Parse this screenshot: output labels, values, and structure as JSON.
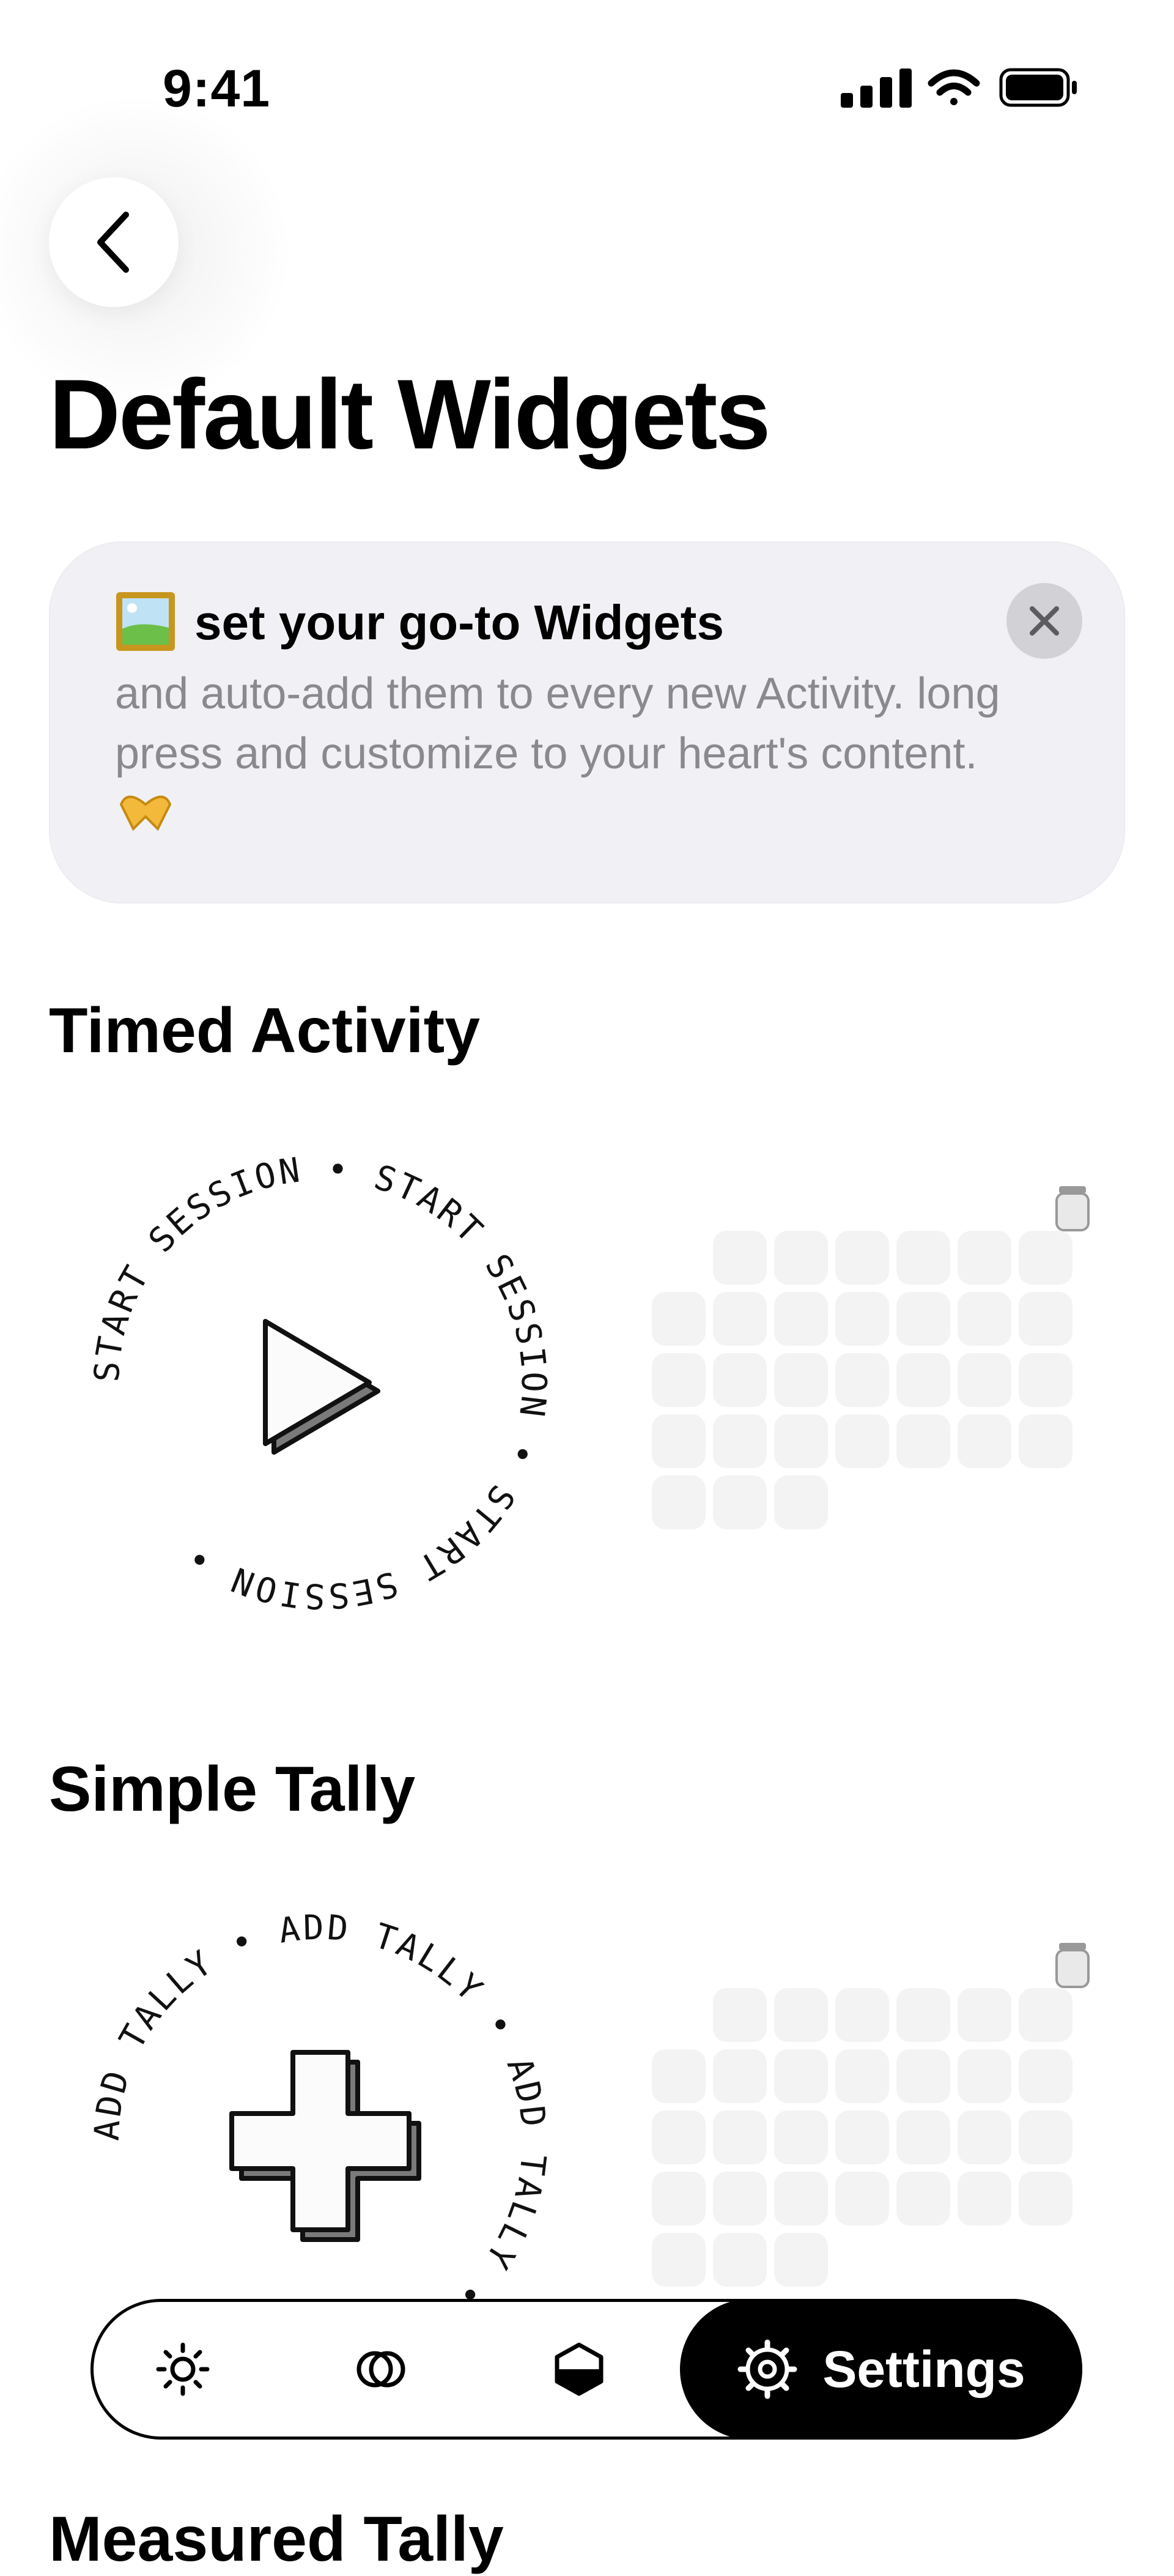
{
  "status_bar": {
    "time": "9:41"
  },
  "header": {
    "title": "Default Widgets"
  },
  "info_card": {
    "title": "set your go-to Widgets",
    "body": "and auto-add them to every new Activity. long press and customize to your heart's content.",
    "icons": [
      "framed-picture-icon",
      "heart-hands-icon"
    ]
  },
  "sections": [
    {
      "title": "Timed Activity",
      "ring_text": "START SESSION",
      "center_icon": "play-icon"
    },
    {
      "title": "Simple Tally",
      "ring_text": "ADD TALLY",
      "center_icon": "plus-icon"
    },
    {
      "title": "Measured Tally"
    }
  ],
  "tab_bar": {
    "tabs": [
      {
        "icon": "sun-icon"
      },
      {
        "icon": "circles-icon"
      },
      {
        "icon": "hexagon-half-icon"
      },
      {
        "icon": "gear-icon",
        "label": "Settings",
        "active": true
      }
    ]
  },
  "colors": {
    "card_bg": "#f1f1f5",
    "muted_text": "#8a8a8e",
    "placeholder_cell": "#f3f3f3",
    "active_tab": "#000000"
  }
}
